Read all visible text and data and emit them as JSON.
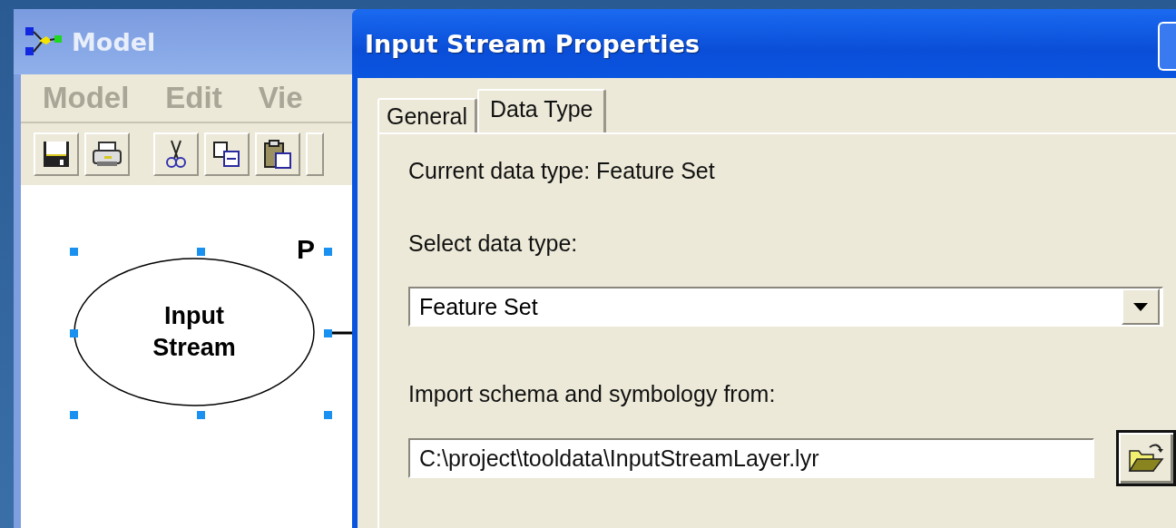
{
  "model_window": {
    "title": "Model",
    "menu": [
      "Model",
      "Edit",
      "Vie"
    ],
    "canvas": {
      "node": {
        "label": "Input Stream",
        "selected": true
      },
      "cut_label": "P"
    }
  },
  "dialog": {
    "title": "Input Stream Properties",
    "tabs": [
      {
        "label": "General",
        "selected": false
      },
      {
        "label": "Data Type",
        "selected": true
      }
    ],
    "current_data_type": "Current data type: Feature Set",
    "select_label": "Select data type:",
    "data_type_select": {
      "value": "Feature Set"
    },
    "import_label": "Import schema and symbology from:",
    "import_path": {
      "value": "C:\\project\\tooldata\\InputStreamLayer.lyr"
    }
  }
}
